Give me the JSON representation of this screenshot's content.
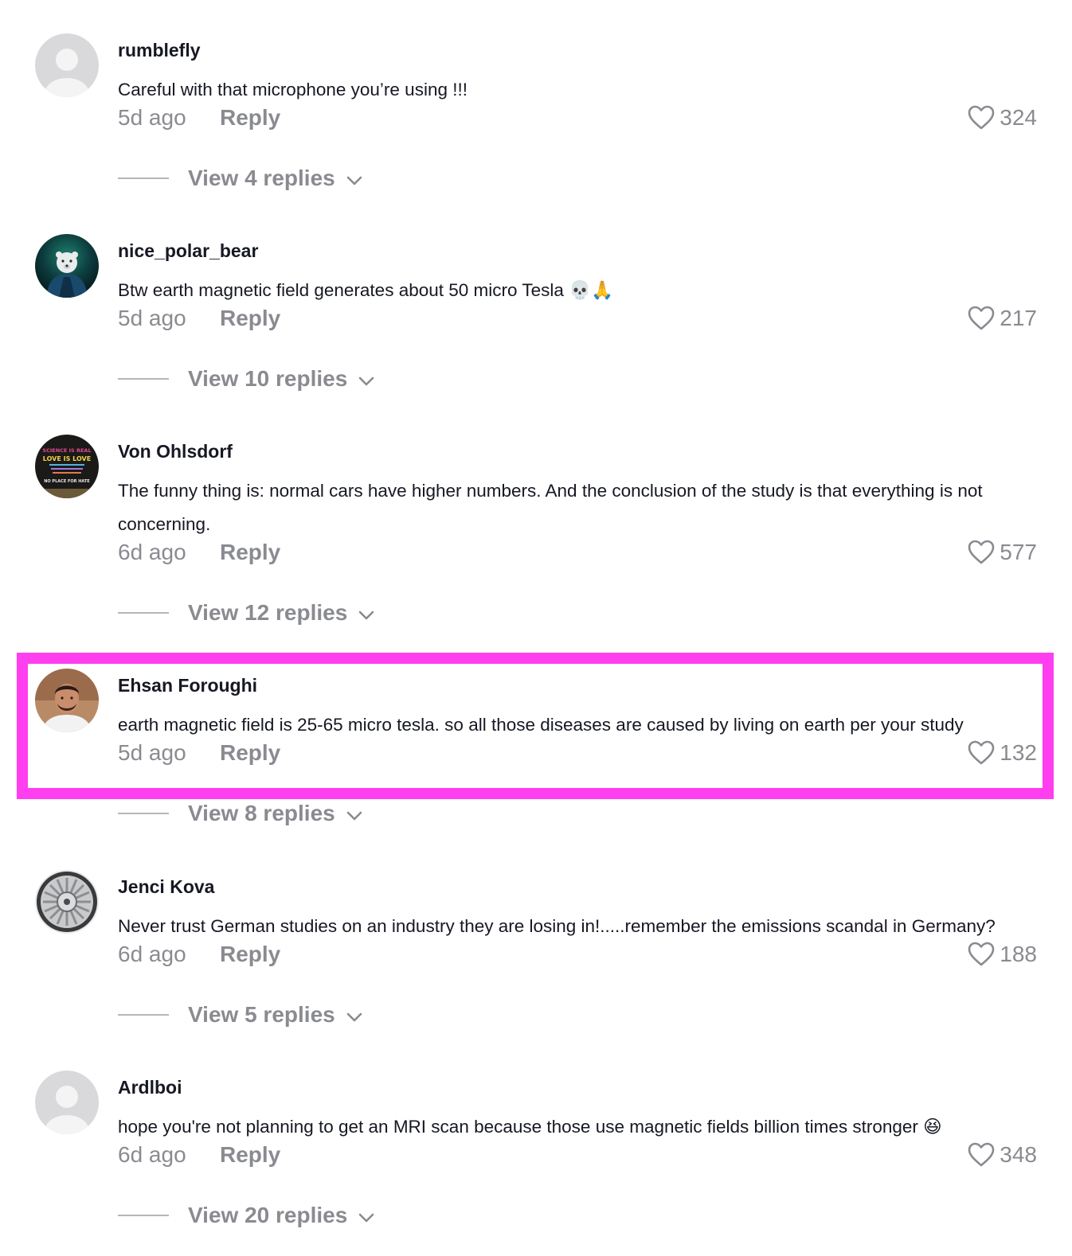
{
  "comments": [
    {
      "username": "rumblefly",
      "text": "Careful with that microphone you’re using !!!",
      "time": "5d ago",
      "reply_label": "Reply",
      "likes": "324",
      "view_replies": "View 4 replies",
      "avatar": "default-avatar"
    },
    {
      "username": "nice_polar_bear",
      "text": "Btw earth magnetic field generates about 50 micro Tesla 💀🙏",
      "time": "5d ago",
      "reply_label": "Reply",
      "likes": "217",
      "view_replies": "View 10 replies",
      "avatar": "polar-bear-avatar"
    },
    {
      "username": "Von Ohlsdorf",
      "text": "The funny thing is: normal cars have higher numbers. And the conclusion of the study is that everything is not concerning.",
      "time": "6d ago",
      "reply_label": "Reply",
      "likes": "577",
      "view_replies": "View 12 replies",
      "avatar": "sign-avatar",
      "avatar_text": [
        "SCIENCE IS REAL",
        "LOVE IS LOVE",
        "NO PLACE FOR HATE"
      ]
    },
    {
      "username": "Ehsan Foroughi",
      "text": "earth magnetic field is 25-65 micro tesla. so all those diseases are caused by living on earth per your study",
      "time": "5d ago",
      "reply_label": "Reply",
      "likes": "132",
      "view_replies": "View 8 replies",
      "avatar": "person-avatar",
      "highlighted": true
    },
    {
      "username": "Jenci Kova",
      "text": "Never trust German studies on an industry they are losing in!.....remember the emissions scandal in Germany?",
      "time": "6d ago",
      "reply_label": "Reply",
      "likes": "188",
      "view_replies": "View 5 replies",
      "avatar": "wheel-rim-avatar"
    },
    {
      "username": "Ardlboi",
      "text": "hope you're not planning to get an MRI scan because those use magnetic fields billion times stronger 😆",
      "time": "6d ago",
      "reply_label": "Reply",
      "likes": "348",
      "view_replies": "View 20 replies",
      "avatar": "default-avatar"
    }
  ],
  "colors": {
    "highlight": "#ff3ef0",
    "muted_text": "#8a8b91",
    "primary_text": "#161823"
  }
}
